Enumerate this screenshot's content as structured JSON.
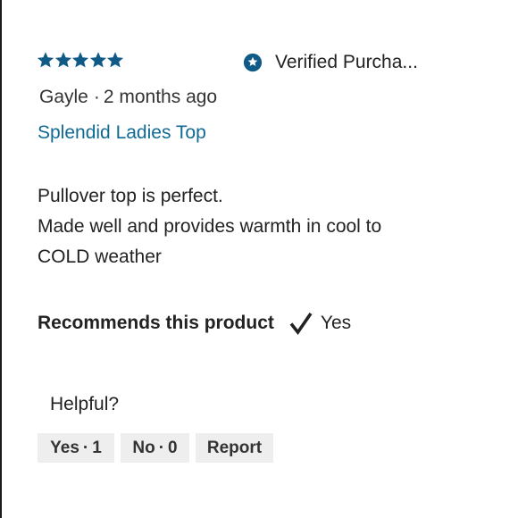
{
  "review": {
    "rating": 5,
    "rating_max": 5,
    "verified_label": "Verified Purcha...",
    "author": "Gayle",
    "separator": "·",
    "time_ago": "2 months ago",
    "product_name": "Splendid Ladies Top",
    "body_lines": [
      "Pullover top is perfect.",
      "Made well and provides warmth in cool to",
      "COLD weather"
    ],
    "recommends_label": "Recommends this product",
    "recommends_value": "Yes",
    "helpful_label": "Helpful?",
    "yes_label": "Yes",
    "yes_count": "1",
    "no_label": "No",
    "no_count": "0",
    "report_label": "Report"
  },
  "colors": {
    "star": "#0f5a86",
    "link": "#0f6a94",
    "verified_icon": "#0f5a86",
    "button_bg": "#eeeeee"
  },
  "icons": {
    "star": "star-icon",
    "verified": "verified-badge-icon",
    "check": "checkmark-icon"
  }
}
